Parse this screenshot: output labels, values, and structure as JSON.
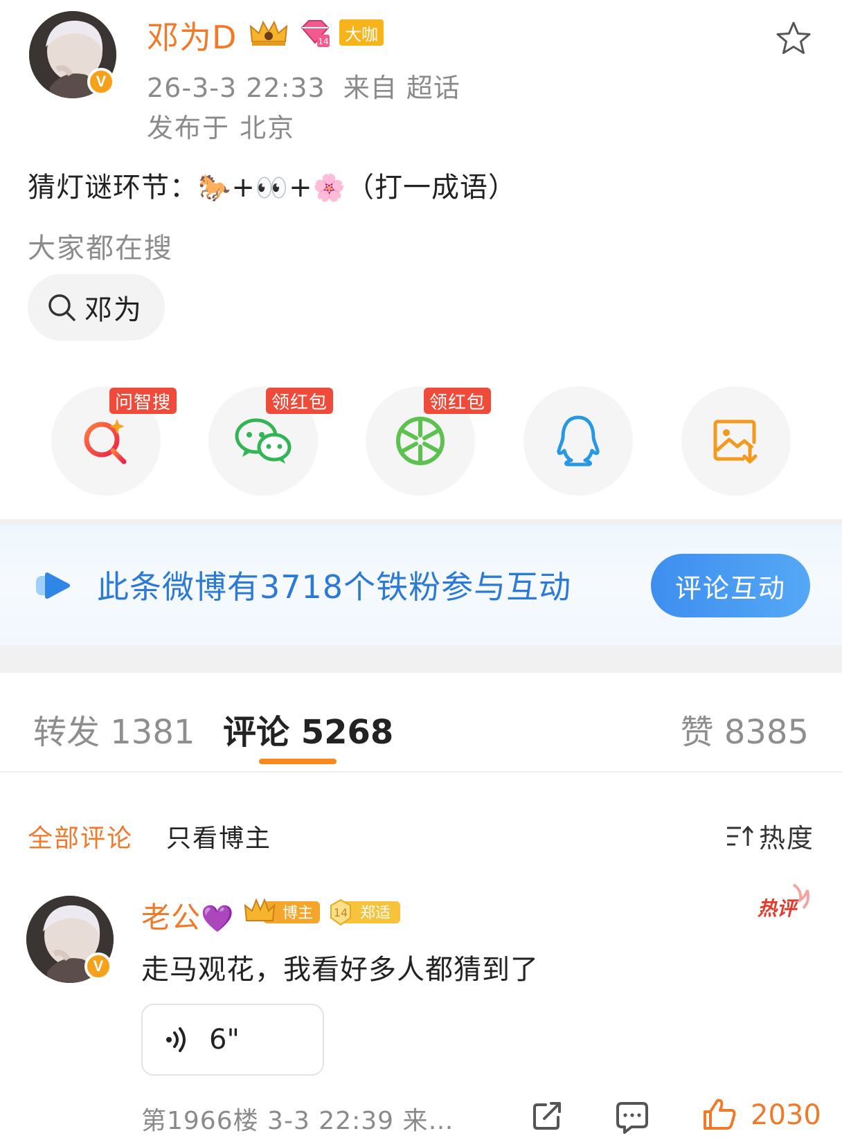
{
  "post": {
    "author_name": "邓为D",
    "vip_label": "大咖",
    "datetime": "26-3-3 22:33",
    "source": "来自 超话",
    "location": "发布于 北京",
    "text_prefix": "猜灯谜环节：",
    "emoji_1": "🐎",
    "plus_1": "+",
    "emoji_2": "👀",
    "plus_2": "+",
    "emoji_3": "🌸",
    "text_suffix": "（打一成语）",
    "hot_search_label": "大家都在搜",
    "hot_search_chip": "邓为"
  },
  "share": {
    "items": [
      {
        "name": "ai-search",
        "tag": "问智搜",
        "icon": "ai-search-icon"
      },
      {
        "name": "wechat",
        "tag": "领红包",
        "icon": "wechat-icon"
      },
      {
        "name": "moments",
        "tag": "领红包",
        "icon": "moments-icon"
      },
      {
        "name": "qq",
        "tag": "",
        "icon": "qq-icon"
      },
      {
        "name": "save-image",
        "tag": "",
        "icon": "save-image-icon"
      }
    ]
  },
  "banner": {
    "text": "此条微博有3718个铁粉参与互动",
    "button": "评论互动"
  },
  "tabs": {
    "forward": "转发 1381",
    "comment": "评论 5268",
    "like": "赞 8385"
  },
  "filters": {
    "all": "全部评论",
    "owner_only": "只看博主",
    "sort": "热度"
  },
  "comment": {
    "author": "老公",
    "author_heart": "💜",
    "badge_blogger": "博主",
    "badge_fan_level": "14",
    "badge_fan_name": "郑适",
    "hot_label": "热评",
    "text": "走马观花，我看好多人都猜到了",
    "voice_duration": "6\"",
    "meta": "第1966楼 3-3 22:39 来…",
    "like_count": "2030"
  },
  "colors": {
    "accent_orange": "#f0792a",
    "banner_blue": "#2c79d6",
    "tag_red": "#ef4b3b"
  }
}
